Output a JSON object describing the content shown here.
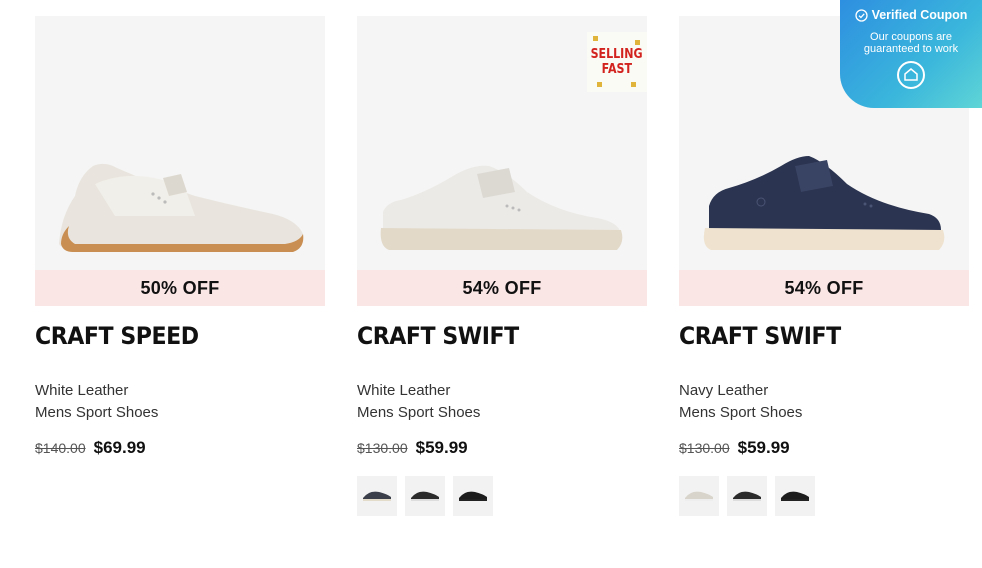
{
  "products": [
    {
      "discount": "50% OFF",
      "name": "CRAFT SPEED",
      "color_desc": "White Leather",
      "category": "Mens Sport Shoes",
      "original_price": "$140.00",
      "sale_price": "$69.99",
      "swatches": []
    },
    {
      "discount": "54% OFF",
      "name": "CRAFT SWIFT",
      "color_desc": "White Leather",
      "category": "Mens Sport Shoes",
      "original_price": "$130.00",
      "sale_price": "$59.99",
      "badge_line1": "SELLING",
      "badge_line2": "FAST",
      "swatches": [
        "navy",
        "white-black",
        "black"
      ]
    },
    {
      "discount": "54% OFF",
      "name": "CRAFT SWIFT",
      "color_desc": "Navy Leather",
      "category": "Mens Sport Shoes",
      "original_price": "$130.00",
      "sale_price": "$59.99",
      "swatches": [
        "white",
        "white-black",
        "black"
      ]
    }
  ],
  "coupon": {
    "title": "Verified Coupon",
    "line1": "Our coupons are",
    "line2": "guaranteed to work"
  },
  "colors": {
    "discount_bg": "#fbe6e6",
    "card_bg": "#f5f5f5",
    "badge_red": "#d2231f",
    "coupon_gradient_start": "#2e8fe0",
    "coupon_gradient_end": "#5fd5d6"
  }
}
